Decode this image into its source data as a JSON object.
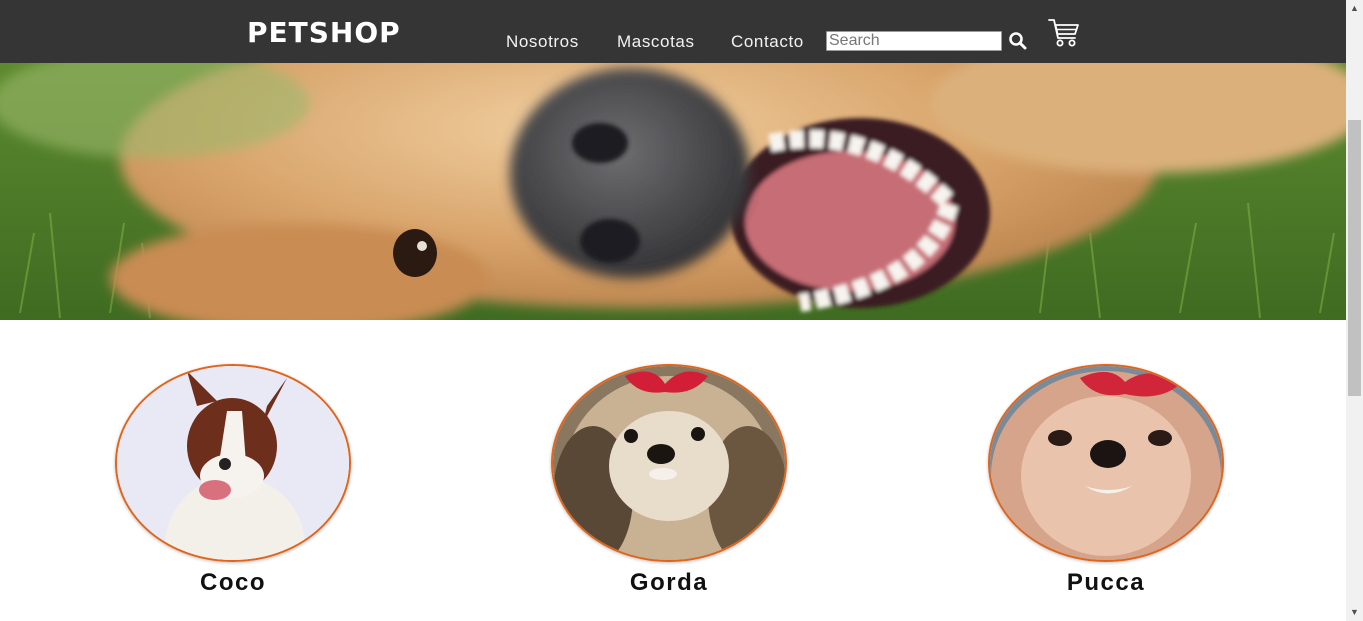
{
  "header": {
    "brand": "PETSHOP",
    "nav": [
      {
        "label": "Nosotros"
      },
      {
        "label": "Mascotas"
      },
      {
        "label": "Contacto"
      }
    ],
    "search": {
      "placeholder": "Search",
      "value": ""
    },
    "icons": {
      "search": "search-icon",
      "cart": "cart-icon"
    }
  },
  "hero": {
    "image": "golden-dog-lying-on-grass"
  },
  "pets": [
    {
      "name": "Coco"
    },
    {
      "name": "Gorda"
    },
    {
      "name": "Pucca"
    }
  ],
  "colors": {
    "header_bg": "#353535",
    "accent_border": "#e0651b",
    "text": "#111111"
  }
}
